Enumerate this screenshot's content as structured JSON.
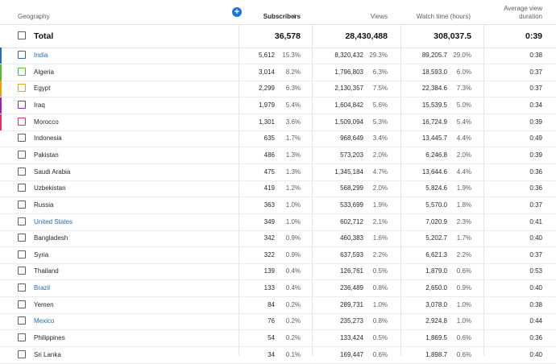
{
  "header": {
    "geography": "Geography",
    "subscribers": "Subscribers",
    "sort_arrow": "↓",
    "add": "+",
    "views": "Views",
    "watch_time": "Watch time (hours)",
    "avg_view_duration_line1": "Average view",
    "avg_view_duration_line2": "duration"
  },
  "total": {
    "label": "Total",
    "subscribers": "36,578",
    "views": "28,430,488",
    "watch_time": "308,037.5",
    "avg": "0:39"
  },
  "colors": {
    "india": "#2a6ab8",
    "algeria": "#5fb63a",
    "egypt": "#f29a1e",
    "iraq": "#8a2ba8",
    "morocco": "#d8355a",
    "link": "#2a6ab8"
  },
  "rows": [
    {
      "name": "India",
      "link": true,
      "color": "#2a6ab8",
      "subs": "5,612",
      "subs_pct": "15.3%",
      "views": "8,320,432",
      "views_pct": "29.3%",
      "watch": "89,205.7",
      "watch_pct": "29.0%",
      "avg": "0:38"
    },
    {
      "name": "Algeria",
      "link": false,
      "color": "#5fb63a",
      "subs": "3,014",
      "subs_pct": "8.2%",
      "views": "1,796,803",
      "views_pct": "6.3%",
      "watch": "18,593.0",
      "watch_pct": "6.0%",
      "avg": "0:37"
    },
    {
      "name": "Egypt",
      "link": false,
      "color": "#f29a1e",
      "subs": "2,299",
      "subs_pct": "6.3%",
      "views": "2,130,357",
      "views_pct": "7.5%",
      "watch": "22,384.6",
      "watch_pct": "7.3%",
      "avg": "0:37"
    },
    {
      "name": "Iraq",
      "link": false,
      "color": "#8a2ba8",
      "subs": "1,979",
      "subs_pct": "5.4%",
      "views": "1,604,842",
      "views_pct": "5.6%",
      "watch": "15,539.5",
      "watch_pct": "5.0%",
      "avg": "0:34"
    },
    {
      "name": "Morocco",
      "link": false,
      "color": "#d8355a",
      "subs": "1,301",
      "subs_pct": "3.6%",
      "views": "1,509,094",
      "views_pct": "5.3%",
      "watch": "16,724.9",
      "watch_pct": "5.4%",
      "avg": "0:39"
    },
    {
      "name": "Indonesia",
      "link": false,
      "color": "",
      "subs": "635",
      "subs_pct": "1.7%",
      "views": "968,649",
      "views_pct": "3.4%",
      "watch": "13,445.7",
      "watch_pct": "4.4%",
      "avg": "0:49"
    },
    {
      "name": "Pakistan",
      "link": false,
      "color": "",
      "subs": "486",
      "subs_pct": "1.3%",
      "views": "573,203",
      "views_pct": "2.0%",
      "watch": "6,246.8",
      "watch_pct": "2.0%",
      "avg": "0:39"
    },
    {
      "name": "Saudi Arabia",
      "link": false,
      "color": "",
      "subs": "475",
      "subs_pct": "1.3%",
      "views": "1,345,184",
      "views_pct": "4.7%",
      "watch": "13,644.6",
      "watch_pct": "4.4%",
      "avg": "0:36"
    },
    {
      "name": "Uzbekistan",
      "link": false,
      "color": "",
      "subs": "419",
      "subs_pct": "1.2%",
      "views": "568,299",
      "views_pct": "2.0%",
      "watch": "5,824.6",
      "watch_pct": "1.9%",
      "avg": "0:36"
    },
    {
      "name": "Russia",
      "link": false,
      "color": "",
      "subs": "363",
      "subs_pct": "1.0%",
      "views": "533,699",
      "views_pct": "1.9%",
      "watch": "5,570.0",
      "watch_pct": "1.8%",
      "avg": "0:37"
    },
    {
      "name": "United States",
      "link": true,
      "color": "",
      "subs": "349",
      "subs_pct": "1.0%",
      "views": "602,712",
      "views_pct": "2.1%",
      "watch": "7,020.9",
      "watch_pct": "2.3%",
      "avg": "0:41"
    },
    {
      "name": "Bangladesh",
      "link": false,
      "color": "",
      "subs": "342",
      "subs_pct": "0.9%",
      "views": "460,383",
      "views_pct": "1.6%",
      "watch": "5,202.7",
      "watch_pct": "1.7%",
      "avg": "0:40"
    },
    {
      "name": "Syria",
      "link": false,
      "color": "",
      "subs": "322",
      "subs_pct": "0.9%",
      "views": "637,593",
      "views_pct": "2.2%",
      "watch": "6,621.3",
      "watch_pct": "2.2%",
      "avg": "0:37"
    },
    {
      "name": "Thailand",
      "link": false,
      "color": "",
      "subs": "139",
      "subs_pct": "0.4%",
      "views": "126,761",
      "views_pct": "0.5%",
      "watch": "1,879.0",
      "watch_pct": "0.6%",
      "avg": "0:53"
    },
    {
      "name": "Brazil",
      "link": true,
      "color": "",
      "subs": "133",
      "subs_pct": "0.4%",
      "views": "236,489",
      "views_pct": "0.8%",
      "watch": "2,650.0",
      "watch_pct": "0.9%",
      "avg": "0:40"
    },
    {
      "name": "Yemen",
      "link": false,
      "color": "",
      "subs": "84",
      "subs_pct": "0.2%",
      "views": "289,731",
      "views_pct": "1.0%",
      "watch": "3,078.0",
      "watch_pct": "1.0%",
      "avg": "0:38"
    },
    {
      "name": "Mexico",
      "link": true,
      "color": "",
      "subs": "76",
      "subs_pct": "0.2%",
      "views": "235,273",
      "views_pct": "0.8%",
      "watch": "2,924.8",
      "watch_pct": "1.0%",
      "avg": "0:44"
    },
    {
      "name": "Philippines",
      "link": false,
      "color": "",
      "subs": "54",
      "subs_pct": "0.2%",
      "views": "133,424",
      "views_pct": "0.5%",
      "watch": "1,869.5",
      "watch_pct": "0.6%",
      "avg": "0:36"
    },
    {
      "name": "Sri Lanka",
      "link": false,
      "color": "",
      "subs": "34",
      "subs_pct": "0.1%",
      "views": "169,447",
      "views_pct": "0.6%",
      "watch": "1,898.7",
      "watch_pct": "0.6%",
      "avg": "0:40"
    }
  ]
}
